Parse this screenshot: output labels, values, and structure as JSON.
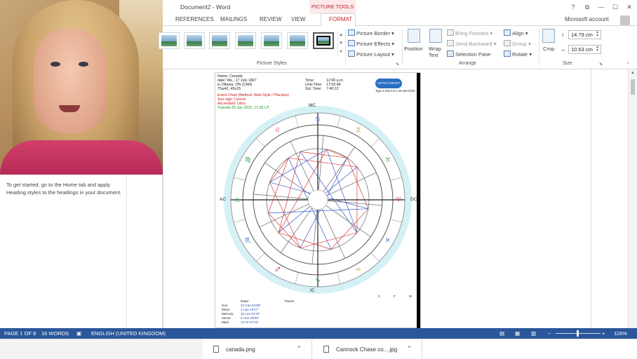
{
  "webcam": {
    "description_hidden": ""
  },
  "nav_pane": {
    "message": "To get started, go to the Home tab and apply Heading styles to the headings in your document."
  },
  "word": {
    "title": "Document2 - Word",
    "picture_tools": "PICTURE TOOLS",
    "window_buttons": [
      "?",
      "⧉",
      "—",
      "☐",
      "✕"
    ],
    "tabs": [
      "REFERENCES",
      "MAILINGS",
      "REVIEW",
      "VIEW",
      "FORMAT"
    ],
    "active_tab": "FORMAT",
    "account": "Microsoft account",
    "ribbon": {
      "picture_styles": {
        "label": "Picture Styles",
        "items": [
          "Picture Border",
          "Picture Effects",
          "Picture Layout"
        ]
      },
      "arrange": {
        "label": "Arrange",
        "position": "Position",
        "wrap_text": "Wrap Text",
        "bring_forward": "Bring Forward",
        "send_backward": "Send Backward",
        "selection_pane": "Selection Pane",
        "align": "Align",
        "group": "Group",
        "rotate": "Rotate"
      },
      "size": {
        "label": "Size",
        "crop": "Crop",
        "height": "14.79 cm",
        "width": "10.53 cm"
      }
    },
    "chart": {
      "name": "Name: Canada",
      "date": "date: We., 17 July 1867",
      "place": "in Ottawa, ON (CAN)",
      "coords": "75w42, 45n25",
      "time_label": "Time:",
      "time_val": "12:00 p.m.",
      "univ_label": "Univ.Time:",
      "univ_val": "17:02:48",
      "sid_label": "Sid. Time:",
      "sid_val": "7:40:12",
      "logo": "ASTRO DIENST",
      "type": "Type 2.GW   0.0-1   26-Jan-2022",
      "event_chart": "Event Chart (Method: Web Style / Placidus)",
      "sun_sign": "Sun sign: Cancer",
      "ascendant": "Ascendant: Libra",
      "transits": "Transits 26 Jan 2022, 17:30 UT",
      "mc": "MC",
      "ic": "IC",
      "ac": "AC",
      "dc": "DC",
      "table_header": [
        "Natal",
        "Transit"
      ],
      "table_rows": [
        [
          "Sun",
          "24 Can 54'58\""
        ],
        [
          "Moon",
          "4 Aqu 16'27\""
        ],
        [
          "Mercury",
          "16 Leo 51'32\""
        ],
        [
          "Venus",
          "5 Can 48'55\""
        ],
        [
          "Mars",
          "14 Vir 57'42\""
        ]
      ],
      "aspect_cols": [
        "C",
        "F",
        "M"
      ]
    }
  },
  "status": {
    "page": "PAGE 1 OF 8",
    "words": "16 WORDS",
    "language": "ENGLISH (UNITED KINGDOM)",
    "zoom": "116%"
  },
  "downloads": [
    {
      "name": "canada.png"
    },
    {
      "name": "Cannock Chase co....jpg"
    }
  ]
}
